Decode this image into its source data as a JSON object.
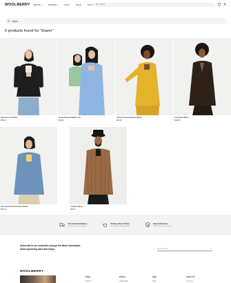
{
  "header": {
    "logo": "WOOLBERRY",
    "nav": [
      {
        "label": "MEN'S",
        "has_caret": true
      },
      {
        "label": "WOMEN",
        "has_caret": true
      },
      {
        "label": "KIDS",
        "has_caret": false
      },
      {
        "label": "SALE",
        "has_caret": false
      },
      {
        "label": "GIFTS",
        "has_caret": true
      },
      {
        "label": "ABOUT",
        "has_caret": true
      }
    ],
    "search_placeholder": "Search"
  },
  "search": {
    "value": "blazer"
  },
  "results": {
    "title": "6 products found for \"blazer\""
  },
  "products": [
    {
      "name": "Relaxed Linen Blazer",
      "price": "$89.00",
      "colors": [
        "#f0efeb",
        "#1b1b1b",
        "#8aa7c9"
      ]
    },
    {
      "name": "Single-Breasted Blazer Suit",
      "price": "$99.00",
      "colors": [
        "#f0efeb",
        "#8fb6e3",
        "#9ac39b"
      ]
    },
    {
      "name": "Tailored Double-Breasted Blazer",
      "price": "$89.00",
      "colors": [
        "#f0efeb",
        "#e3b12a",
        "#3b2a1e"
      ]
    },
    {
      "name": "Long Fitted Blazer",
      "price": "$109.00",
      "colors": [
        "#f0efeb",
        "#2e2218",
        "#a25b2a"
      ]
    },
    {
      "name": "Oversized Double-Breasted Blazer",
      "price": "$99.00",
      "colors": [
        "#f0efeb",
        "#6b8fb7",
        "#d8c9a3"
      ]
    },
    {
      "name": "Checked Blazer",
      "price": "$99.00",
      "colors": [
        "#f0efeb",
        "#9a6b45",
        "#1a1a1a"
      ]
    }
  ],
  "features": [
    {
      "icon": "truck-icon",
      "title": "Free Standard Delivery",
      "desc": "Lorem ipsum dolor sit amet"
    },
    {
      "icon": "return-icon",
      "title": "30 Days Return Policy",
      "desc": "Hassle-free returning policy"
    },
    {
      "icon": "shield-icon",
      "title": "Secure Payments",
      "desc": "Certified & secure checkout"
    }
  ],
  "newsletter": {
    "text": "Subscribe to our newsletter and get the latest information about upcoming sales and drops.",
    "email_placeholder": "Email Address"
  },
  "footer": {
    "logo": "WOOLBERRY",
    "columns": [
      {
        "title": "Shop",
        "item": "Women"
      },
      {
        "title": "Orders",
        "item": "Order status"
      },
      {
        "title": "Help",
        "item": "FAQ"
      },
      {
        "title": "About Us",
        "item": "Our story"
      }
    ]
  }
}
